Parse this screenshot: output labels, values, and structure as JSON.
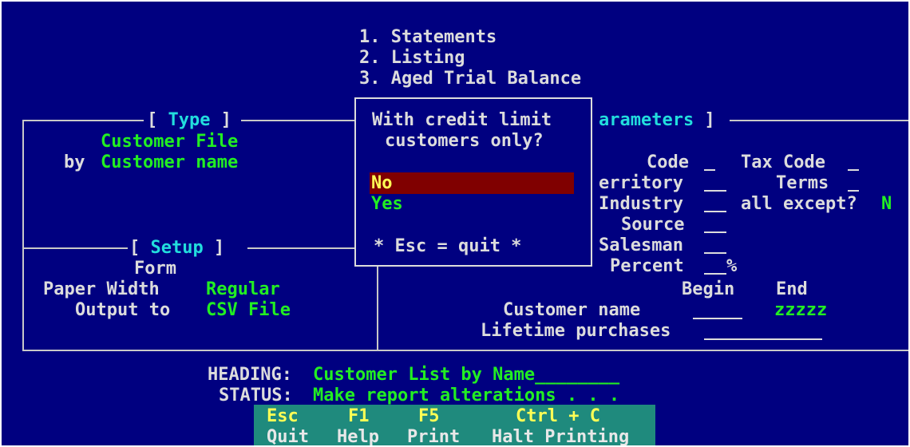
{
  "menu": {
    "items": [
      "1. Statements",
      "2. Listing",
      "3. Aged Trial Balance"
    ]
  },
  "type_section": {
    "title": "[ Type ]",
    "line1": "Customer File",
    "by_label": "by",
    "line2": "Customer name"
  },
  "parameters_section": {
    "title_visible": "arameters ]",
    "code_label": "Code",
    "tax_code_label": "Tax Code",
    "territory_label": "erritory",
    "terms_label": "Terms",
    "industry_label": "Industry",
    "all_except_label": "all except?",
    "all_except_value": "N",
    "source_label": "Source",
    "salesman_label": "Salesman",
    "percent_label": "Percent",
    "percent_sign": "%"
  },
  "setup_section": {
    "title": "[ Setup ]",
    "form_label": "Form",
    "paper_width_label": "Paper Width",
    "paper_width_value": "Regular",
    "output_label": "Output to",
    "output_value": "CSV File"
  },
  "range": {
    "begin_label": "Begin",
    "end_label": "End",
    "customer_name_label": "Customer name",
    "customer_name_end": "zzzzz",
    "lifetime_label": "Lifetime purchases"
  },
  "popup": {
    "line1": "With credit limit",
    "line2": "customers only?",
    "option_no": "No",
    "option_yes": "Yes",
    "footer": "* Esc = quit *"
  },
  "footer": {
    "heading_label": "HEADING:",
    "heading_value": "Customer List by Name________",
    "status_label": "STATUS:",
    "status_value": "Make report alterations . . ."
  },
  "function_keys": [
    {
      "key": "Esc",
      "label": "Quit"
    },
    {
      "key": "F1",
      "label": "Help"
    },
    {
      "key": "F5",
      "label": "Print"
    },
    {
      "key": "Ctrl + C",
      "label": "Halt Printing"
    }
  ],
  "colors": {
    "background": "#000080",
    "label": "#dcdcdc",
    "value": "#22ee22",
    "title": "#22dddd",
    "highlight_bar": "#800000",
    "function_bar": "#1f8a7d",
    "key_text": "#ffff55"
  }
}
